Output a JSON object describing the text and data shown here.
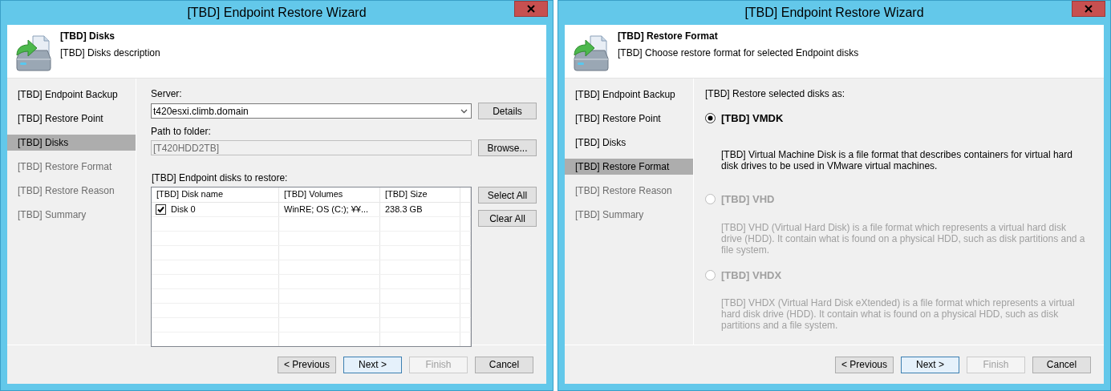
{
  "windows": [
    {
      "title": "[TBD] Endpoint Restore Wizard",
      "header": {
        "title": "[TBD] Disks",
        "description": "[TBD] Disks description"
      },
      "steps": [
        {
          "label": "[TBD] Endpoint Backup",
          "selected": false,
          "disabled": false
        },
        {
          "label": "[TBD] Restore Point",
          "selected": false,
          "disabled": false
        },
        {
          "label": "[TBD] Disks",
          "selected": true,
          "disabled": false
        },
        {
          "label": "[TBD] Restore Format",
          "selected": false,
          "disabled": true
        },
        {
          "label": "[TBD] Restore Reason",
          "selected": false,
          "disabled": true
        },
        {
          "label": "[TBD] Summary",
          "selected": false,
          "disabled": true
        }
      ],
      "page": {
        "kind": "disks",
        "server_label": "Server:",
        "server_value": "t420esxi.climb.domain",
        "details_button": "Details",
        "path_label": "Path to folder:",
        "path_value": "[T420HDD2TB]",
        "browse_button": "Browse...",
        "disks_label": "[TBD] Endpoint disks to restore:",
        "columns": [
          "[TBD] Disk name",
          "[TBD] Volumes",
          "[TBD] Size"
        ],
        "rows": [
          {
            "checked": true,
            "cells": [
              "Disk 0",
              "WinRE; OS (C:); ¥¥...",
              "238.3 GB"
            ]
          }
        ],
        "select_all_button": "Select All",
        "clear_all_button": "Clear All"
      },
      "buttons": [
        {
          "label": "< Previous",
          "default": false,
          "disabled": false
        },
        {
          "label": "Next >",
          "default": true,
          "disabled": false
        },
        {
          "label": "Finish",
          "default": false,
          "disabled": true
        },
        {
          "label": "Cancel",
          "default": false,
          "disabled": false
        }
      ]
    },
    {
      "title": "[TBD] Endpoint Restore Wizard",
      "header": {
        "title": "[TBD] Restore Format",
        "description": "[TBD] Choose restore format for selected Endpoint disks"
      },
      "steps": [
        {
          "label": "[TBD] Endpoint Backup",
          "selected": false,
          "disabled": false
        },
        {
          "label": "[TBD] Restore Point",
          "selected": false,
          "disabled": false
        },
        {
          "label": "[TBD] Disks",
          "selected": false,
          "disabled": false
        },
        {
          "label": "[TBD] Restore Format",
          "selected": true,
          "disabled": false
        },
        {
          "label": "[TBD] Restore Reason",
          "selected": false,
          "disabled": true
        },
        {
          "label": "[TBD] Summary",
          "selected": false,
          "disabled": true
        }
      ],
      "page": {
        "kind": "format",
        "prompt": "[TBD] Restore selected disks as:",
        "options": [
          {
            "title": "[TBD] VMDK",
            "description": "[TBD] Virtual Machine Disk is a file format that describes containers for virtual hard disk drives to be used in VMware virtual machines.",
            "selected": true,
            "disabled": false
          },
          {
            "title": "[TBD] VHD",
            "description": "[TBD] VHD (Virtual Hard Disk) is a file format which represents a virtual hard disk drive (HDD). It contain what is found on a physical HDD, such as disk partitions and a file system.",
            "selected": false,
            "disabled": true
          },
          {
            "title": "[TBD] VHDX",
            "description": "[TBD] VHDX (Virtual Hard Disk eXtended) is a file format which represents a virtual hard disk drive (HDD). It contain what is found on a physical HDD, such as disk partitions and a file system.",
            "selected": false,
            "disabled": true
          }
        ]
      },
      "buttons": [
        {
          "label": "< Previous",
          "default": false,
          "disabled": false
        },
        {
          "label": "Next >",
          "default": true,
          "disabled": false
        },
        {
          "label": "Finish",
          "default": false,
          "disabled": true
        },
        {
          "label": "Cancel",
          "default": false,
          "disabled": false
        }
      ]
    }
  ]
}
